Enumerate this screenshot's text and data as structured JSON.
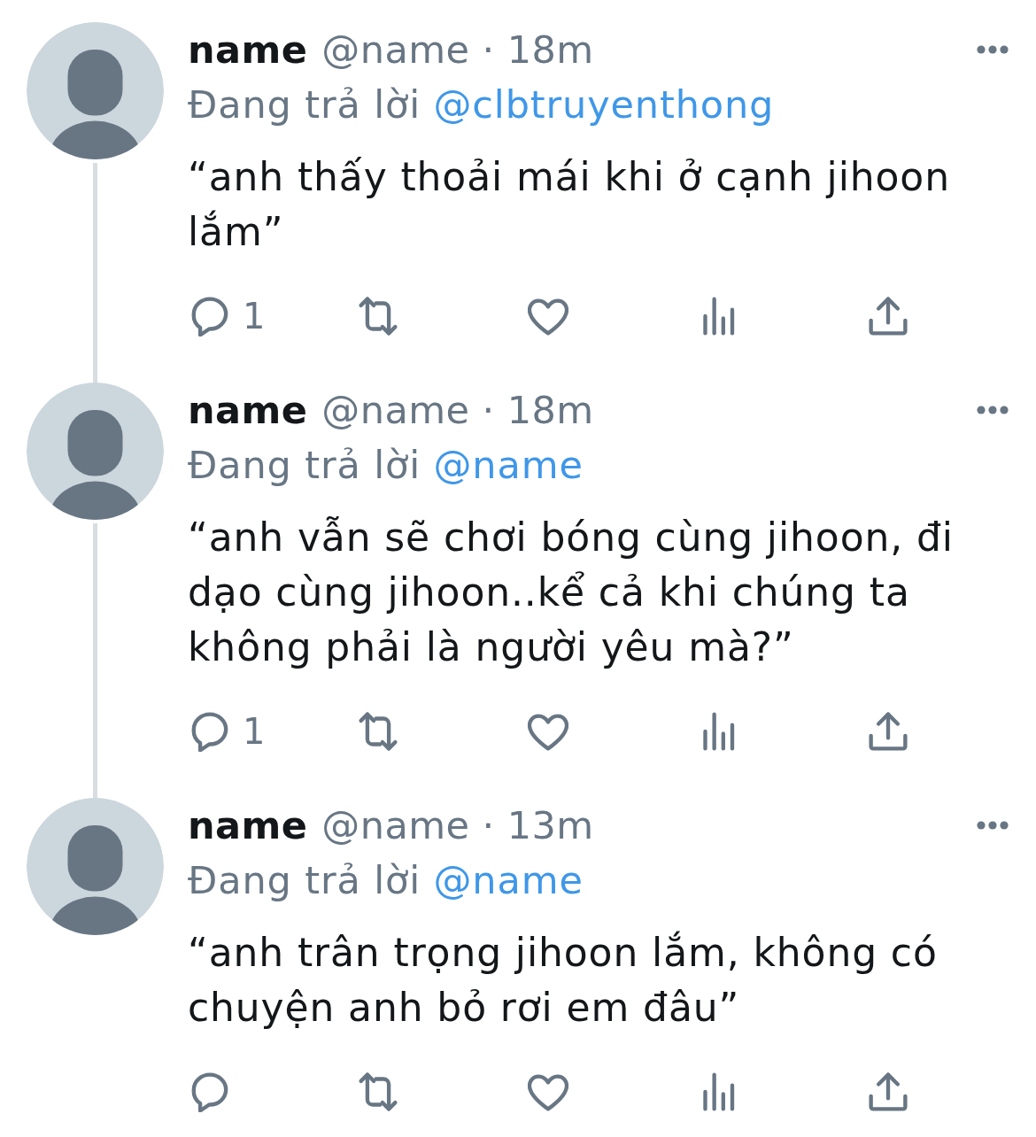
{
  "tweets": [
    {
      "name": "name",
      "meta": "@name · 18m",
      "reply_prefix": "Đang trả lời",
      "reply_to": "@clbtruyenthong",
      "body": "“anh thấy thoải mái khi ở cạnh jihoon lắm”",
      "reply_count": "1"
    },
    {
      "name": "name",
      "meta": "@name · 18m",
      "reply_prefix": "Đang trả lời",
      "reply_to": "@name",
      "body": "“anh vẫn sẽ chơi bóng cùng jihoon, đi dạo cùng jihoon..kể cả khi chúng ta không phải là người yêu mà?”",
      "reply_count": "1"
    },
    {
      "name": "name",
      "meta": "@name · 13m",
      "reply_prefix": "Đang trả lời",
      "reply_to": "@name",
      "body": "“anh trân trọng jihoon lắm, không có chuyện anh bỏ rơi em đâu”"
    }
  ]
}
